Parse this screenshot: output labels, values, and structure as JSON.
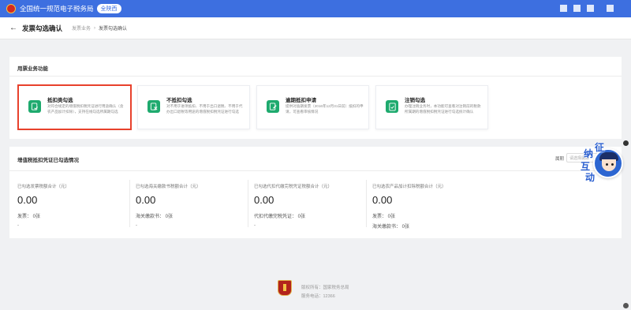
{
  "header": {
    "title": "全国统一规范电子税务局",
    "region": "全陕西",
    "accent": "#3d6fe0"
  },
  "breadcrumb": {
    "back_icon": "arrow-left-icon",
    "page_title": "发票勾选确认",
    "items": [
      "发票业务",
      "发票勾选确认"
    ],
    "separator": "›"
  },
  "section1": {
    "title": "用票业务功能",
    "cards": [
      {
        "title": "抵扣类勾选",
        "desc": "对符合规定的增值税扣税凭证进行用途确认（含农产品加计扣除），支持在线勾选所属期勾选",
        "icon": "invoice-check-icon",
        "selected": true
      },
      {
        "title": "不抵扣勾选",
        "desc": "对不用于进项抵扣、不用于出口退税、不用于代办出口退税等用途的增值税扣税凭证进行勾选",
        "icon": "invoice-cross-icon",
        "selected": false
      },
      {
        "title": "逾期抵扣申请",
        "desc": "提供对逾期发票（2016年12月31日前）抵扣的申请，可查看审核情况",
        "icon": "pen-edit-icon",
        "selected": false
      },
      {
        "title": "注销勾选",
        "desc": "办理注销业务时，本功能可查看对注销前的税款所属期的增值税扣税凭证进行勾选统计确认",
        "icon": "document-check-icon",
        "selected": false
      }
    ]
  },
  "section2": {
    "title": "增值税抵扣凭证已勾选情况",
    "date_label": "属期",
    "date_placeholder": "请选择属期",
    "columns": [
      {
        "label": "已勾选发票税额合计（元）",
        "value": "0.00",
        "lines": [
          "发票：  0张",
          "-"
        ]
      },
      {
        "label": "已勾选海关缴款书税额合计（元）",
        "value": "0.00",
        "lines": [
          "海关缴款书：  0张",
          "-"
        ]
      },
      {
        "label": "已勾选代扣代缴完税凭证税额合计（元）",
        "value": "0.00",
        "lines": [
          "代扣代缴完税凭证：  0张",
          "-"
        ]
      },
      {
        "label": "已勾选农产品加计扣除税额合计（元）",
        "value": "0.00",
        "lines": [
          "发票：  0张",
          "海关缴款书：  0张"
        ]
      }
    ]
  },
  "footer": {
    "sponsor": "版权所有：国家税务总局",
    "hotline": "服务电话：12366"
  },
  "assistant": {
    "chars": [
      "征",
      "纳",
      "互",
      "动"
    ]
  }
}
